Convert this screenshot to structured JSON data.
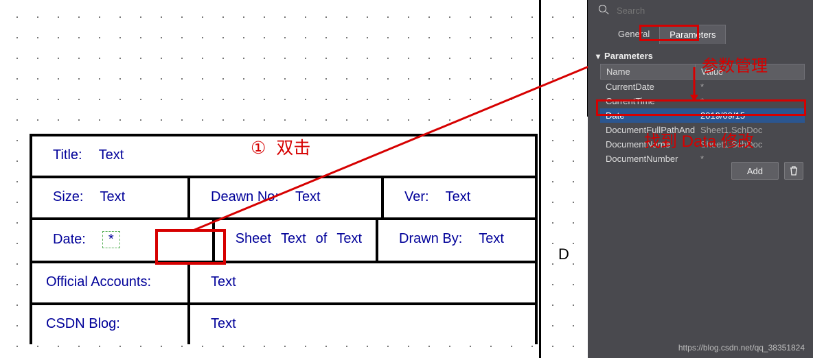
{
  "sheet": {
    "zone_label": "D",
    "title_block": {
      "title_lbl": "Title:",
      "title_val": "Text",
      "size_lbl": "Size:",
      "size_val": "Text",
      "drawno_lbl": "Deawn No:",
      "drawno_val": "Text",
      "ver_lbl": "Ver:",
      "ver_val": "Text",
      "date_lbl": "Date:",
      "date_val": "*",
      "sheet_lbl": "Sheet",
      "sheet_val": "Text",
      "sheet_of": "of",
      "sheet_total": "Text",
      "drawnby_lbl": "Drawn By:",
      "drawnby_val": "Text",
      "official_lbl": "Official Accounts:",
      "official_val": "Text",
      "csdn_lbl": "CSDN Blog:",
      "csdn_val": "Text"
    }
  },
  "panel": {
    "search_placeholder": "Search",
    "tabs": {
      "general": "General",
      "parameters": "Parameters"
    },
    "section": "Parameters",
    "col_name": "Name",
    "col_value": "Value",
    "rows": [
      {
        "name": "CurrentDate",
        "value": "*"
      },
      {
        "name": "CurrentTime",
        "value": "*"
      },
      {
        "name": "Date",
        "value": "2019/09/15"
      },
      {
        "name": "DocumentFullPathAndNa",
        "value": "Sheet1.SchDoc"
      },
      {
        "name": "DocumentName",
        "value": "Sheet1.SchDoc"
      },
      {
        "name": "DocumentNumber",
        "value": "*"
      }
    ],
    "add_btn": "Add"
  },
  "annotations": {
    "dblclick_num": "①",
    "dblclick_txt": "双击",
    "param_mgr": "参数管理",
    "find_data": "找到 Data 修改"
  },
  "watermark": "https://blog.csdn.net/qq_38351824"
}
